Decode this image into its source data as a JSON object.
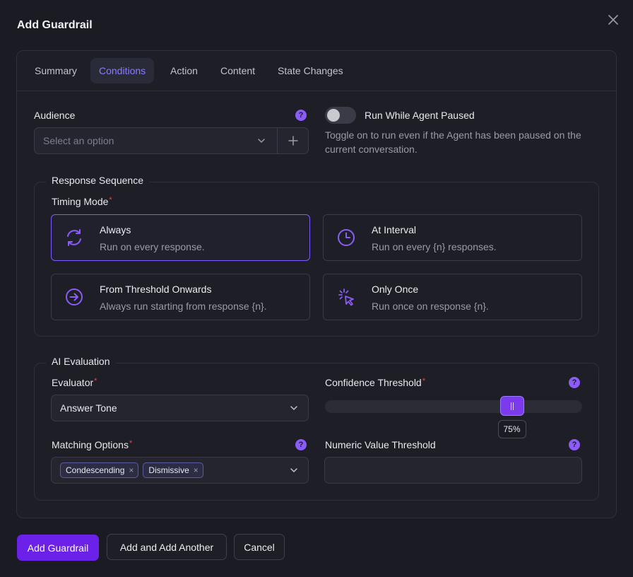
{
  "modal": {
    "title": "Add Guardrail"
  },
  "tabs": [
    {
      "label": "Summary"
    },
    {
      "label": "Conditions",
      "active": true
    },
    {
      "label": "Action"
    },
    {
      "label": "Content"
    },
    {
      "label": "State Changes"
    }
  ],
  "audience": {
    "label": "Audience",
    "placeholder": "Select an option",
    "help_icon": "question-icon"
  },
  "run_paused": {
    "label": "Run While Agent Paused",
    "enabled": false,
    "description": "Toggle on to run even if the Agent has been paused on the current conversation."
  },
  "response_sequence": {
    "legend": "Response Sequence",
    "timing_label": "Timing Mode",
    "required_mark": "*",
    "options": [
      {
        "title": "Always",
        "desc": "Run on every response.",
        "icon": "refresh-icon",
        "selected": true
      },
      {
        "title": "At Interval",
        "desc": "Run on every {n} responses.",
        "icon": "clock-icon",
        "selected": false
      },
      {
        "title": "From Threshold Onwards",
        "desc": "Always run starting from response {n}.",
        "icon": "arrow-right-circle-icon",
        "selected": false
      },
      {
        "title": "Only Once",
        "desc": "Run once on response {n}.",
        "icon": "click-burst-icon",
        "selected": false
      }
    ]
  },
  "ai_evaluation": {
    "legend": "AI Evaluation",
    "evaluator_label": "Evaluator",
    "evaluator_value": "Answer Tone",
    "confidence_label": "Confidence Threshold",
    "confidence_value": 0.75,
    "confidence_text": "75%",
    "matching_label": "Matching Options",
    "matching_chips": [
      "Condescending",
      "Dismissive"
    ],
    "numeric_label": "Numeric Value Threshold",
    "numeric_value": ""
  },
  "footer": {
    "add_label": "Add Guardrail",
    "add_another_label": "Add and Add Another",
    "cancel_label": "Cancel"
  },
  "colors": {
    "accent": "#7c3aed",
    "background": "#1a1b23",
    "required": "#e5484d"
  }
}
